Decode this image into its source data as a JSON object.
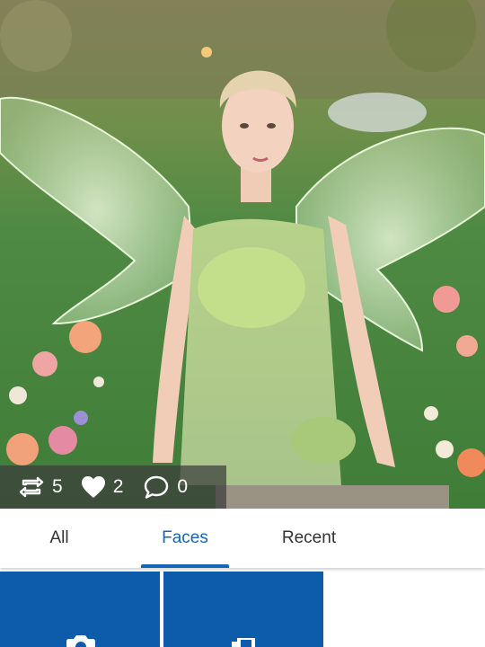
{
  "stats": {
    "reposts": "5",
    "likes": "2",
    "comments": "0",
    "icons": [
      "repost-icon",
      "heart-icon",
      "comment-icon"
    ]
  },
  "tabs": {
    "items": [
      {
        "label": "All"
      },
      {
        "label": "Faces"
      },
      {
        "label": "Recent"
      }
    ],
    "selected": "Faces"
  },
  "tiles": [
    {
      "icon": "camera-icon"
    },
    {
      "icon": "gallery-icon"
    }
  ],
  "colors": {
    "accent": "#1565b8",
    "tile": "#0d5cab",
    "stats_overlay": "#3c3c3c"
  }
}
